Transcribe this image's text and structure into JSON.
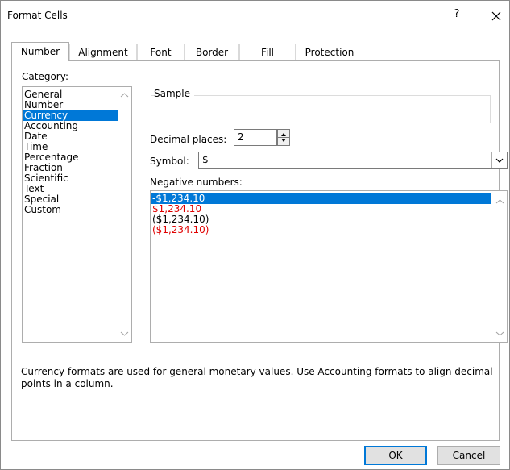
{
  "dialog": {
    "title": "Format Cells",
    "help_glyph": "?",
    "close_glyph": "✕"
  },
  "tabs": [
    {
      "label": "Number",
      "active": true
    },
    {
      "label": "Alignment",
      "active": false
    },
    {
      "label": "Font",
      "active": false
    },
    {
      "label": "Border",
      "active": false
    },
    {
      "label": "Fill",
      "active": false
    },
    {
      "label": "Protection",
      "active": false
    }
  ],
  "category": {
    "label": "Category:",
    "items": [
      "General",
      "Number",
      "Currency",
      "Accounting",
      "Date",
      "Time",
      "Percentage",
      "Fraction",
      "Scientific",
      "Text",
      "Special",
      "Custom"
    ],
    "selected": "Currency"
  },
  "sample": {
    "label": "Sample",
    "value": ""
  },
  "decimal_places": {
    "label": "Decimal places:",
    "value": "2"
  },
  "symbol": {
    "label": "Symbol:",
    "value": "$"
  },
  "negative_numbers": {
    "label": "Negative numbers:",
    "items": [
      {
        "text": "-$1,234.10",
        "color": "#000000",
        "selected": true
      },
      {
        "text": "$1,234.10",
        "color": "#e00000",
        "selected": false
      },
      {
        "text": "($1,234.10)",
        "color": "#000000",
        "selected": false
      },
      {
        "text": "($1,234.10)",
        "color": "#e00000",
        "selected": false
      }
    ]
  },
  "description": "Currency formats are used for general monetary values.  Use Accounting formats to align decimal points in a column.",
  "buttons": {
    "ok": "OK",
    "cancel": "Cancel"
  },
  "colors": {
    "accent": "#0078d7",
    "negative_red": "#e00000"
  }
}
